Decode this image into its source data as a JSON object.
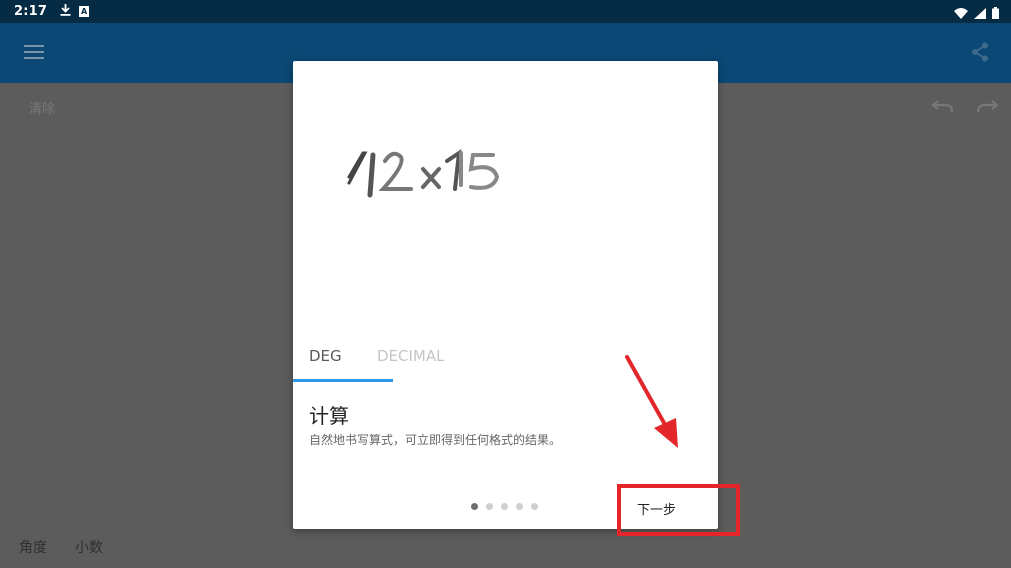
{
  "status_bar": {
    "time": "2:17",
    "icons": [
      "download-icon",
      "a-box-icon",
      "wifi-icon",
      "signal-icon",
      "battery-icon"
    ]
  },
  "app_bar": {
    "menu_icon": "hamburger-menu-icon",
    "share_icon": "share-icon"
  },
  "workspace": {
    "clear_label": "清除",
    "undo_icon": "undo-icon",
    "redo_icon": "redo-icon",
    "bottom_bar": {
      "angle_label": "角度",
      "decimal_label": "小数"
    }
  },
  "dialog": {
    "handwriting_sample": "12×15",
    "tabs": [
      {
        "label": "DEG",
        "selected": true
      },
      {
        "label": "DECIMAL",
        "selected": false
      }
    ],
    "title": "计算",
    "description": "自然地书写算式，可立即得到任何格式的结果。",
    "page_indicator": {
      "total": 5,
      "current": 1
    },
    "next_button": "下一步"
  },
  "colors": {
    "status_bar": "#062b45",
    "app_bar": "#0b4875",
    "tab_indicator": "#2d98e6",
    "annotation": "#e3262a"
  }
}
